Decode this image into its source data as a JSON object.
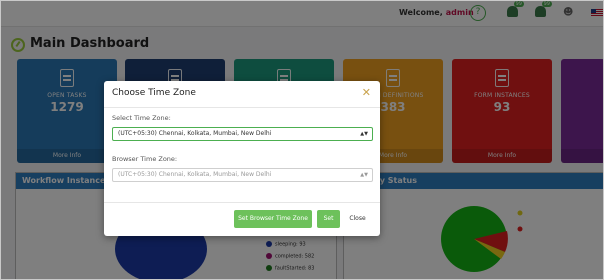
{
  "header": {
    "welcome_label": "Welcome,",
    "username": "admin",
    "help_icon": "question-circle-icon",
    "badge_one": "99",
    "badge_two": "99"
  },
  "main": {
    "title": "Main Dashboard"
  },
  "cards": [
    {
      "label": "OPEN TASKS",
      "value": "1279",
      "footer": "More Info",
      "color": "#2a78b6"
    },
    {
      "label": "",
      "value": "",
      "footer": "",
      "color": "#1e3f73"
    },
    {
      "label": "",
      "value": "",
      "footer": "",
      "color": "#1c9a7f"
    },
    {
      "label": "FORM DEFINITIONS",
      "value": "383",
      "footer": "More Info",
      "color": "#f0a020"
    },
    {
      "label": "FORM INSTANCES",
      "value": "93",
      "footer": "More Info",
      "color": "#e02020"
    },
    {
      "label": "",
      "value": "",
      "footer": "",
      "color": "#7a2b98"
    }
  ],
  "panels": {
    "left_title": "Workflow Instances by",
    "right_title": "by Status",
    "legend": [
      {
        "label": "sleeping: 93",
        "color": "#1d3aa8"
      },
      {
        "label": "completed: 582",
        "color": "#a01070"
      },
      {
        "label": "faultStarted: 83",
        "color": "#1e7a1e"
      }
    ]
  },
  "modal": {
    "title": "Choose Time Zone",
    "select_label": "Select Time Zone:",
    "select_value": "(UTC+05:30) Chennai, Kolkata, Mumbai, New Delhi",
    "browser_label": "Browser Time Zone:",
    "browser_value": "(UTC+05:30) Chennai, Kolkata, Mumbai, New Delhi",
    "btn_browser": "Set Browser Time Zone",
    "btn_set": "Set",
    "btn_close": "Close"
  }
}
